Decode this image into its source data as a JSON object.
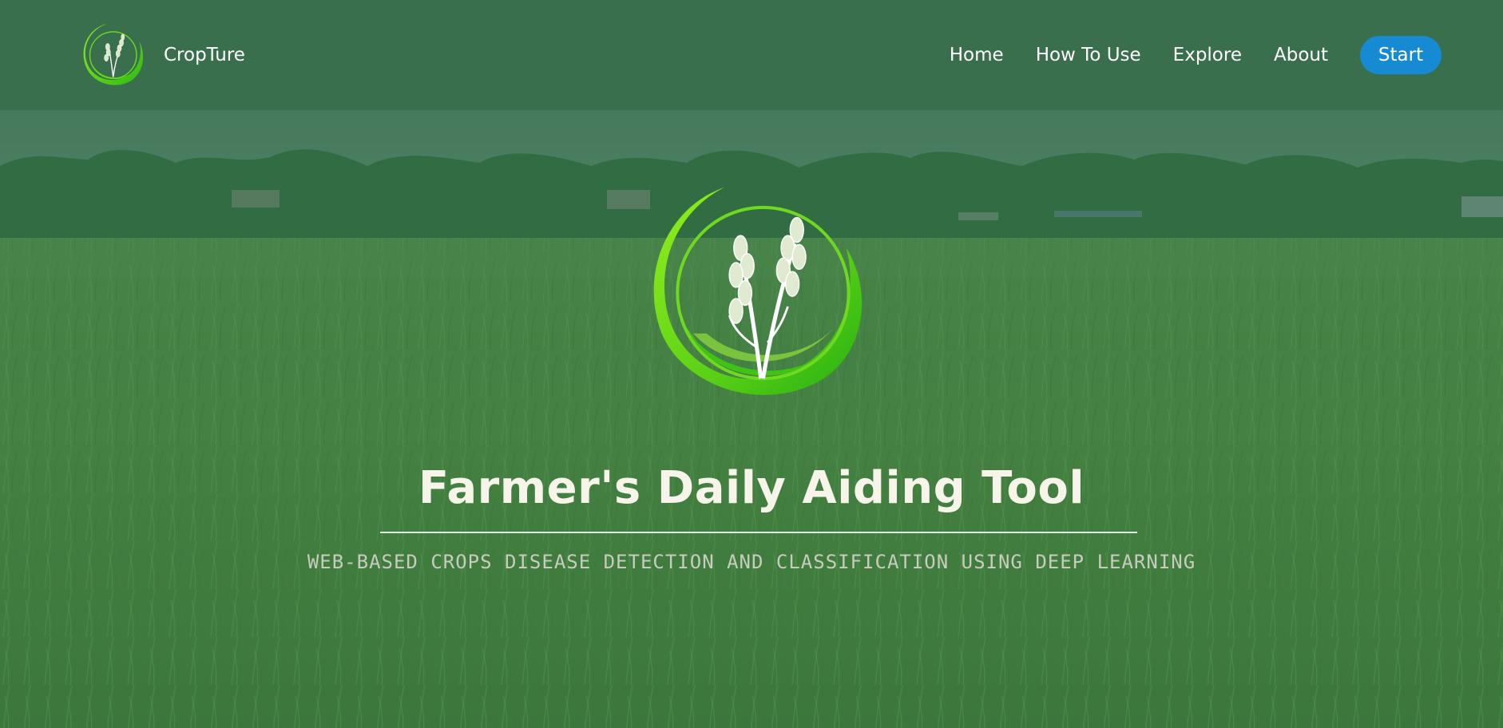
{
  "brand": {
    "name": "CropTure",
    "logo_icon": "wheat-circle-logo-icon"
  },
  "nav": {
    "links": [
      "Home",
      "How To Use",
      "Explore",
      "About"
    ],
    "start_label": "Start"
  },
  "hero": {
    "title": "Farmer's Daily Aiding Tool",
    "subtitle": "WEB-BASED CROPS DISEASE DETECTION AND CLASSIFICATION USING DEEP LEARNING",
    "logo_icon": "wheat-circle-logo-icon",
    "background": "rice-field-photo"
  },
  "colors": {
    "navbar": "#3a6f4d",
    "start_button": "#168ad2",
    "logo_green": "#63d81a",
    "title_text": "#f7f5ea",
    "subtitle_text": "#c7ccbf"
  }
}
